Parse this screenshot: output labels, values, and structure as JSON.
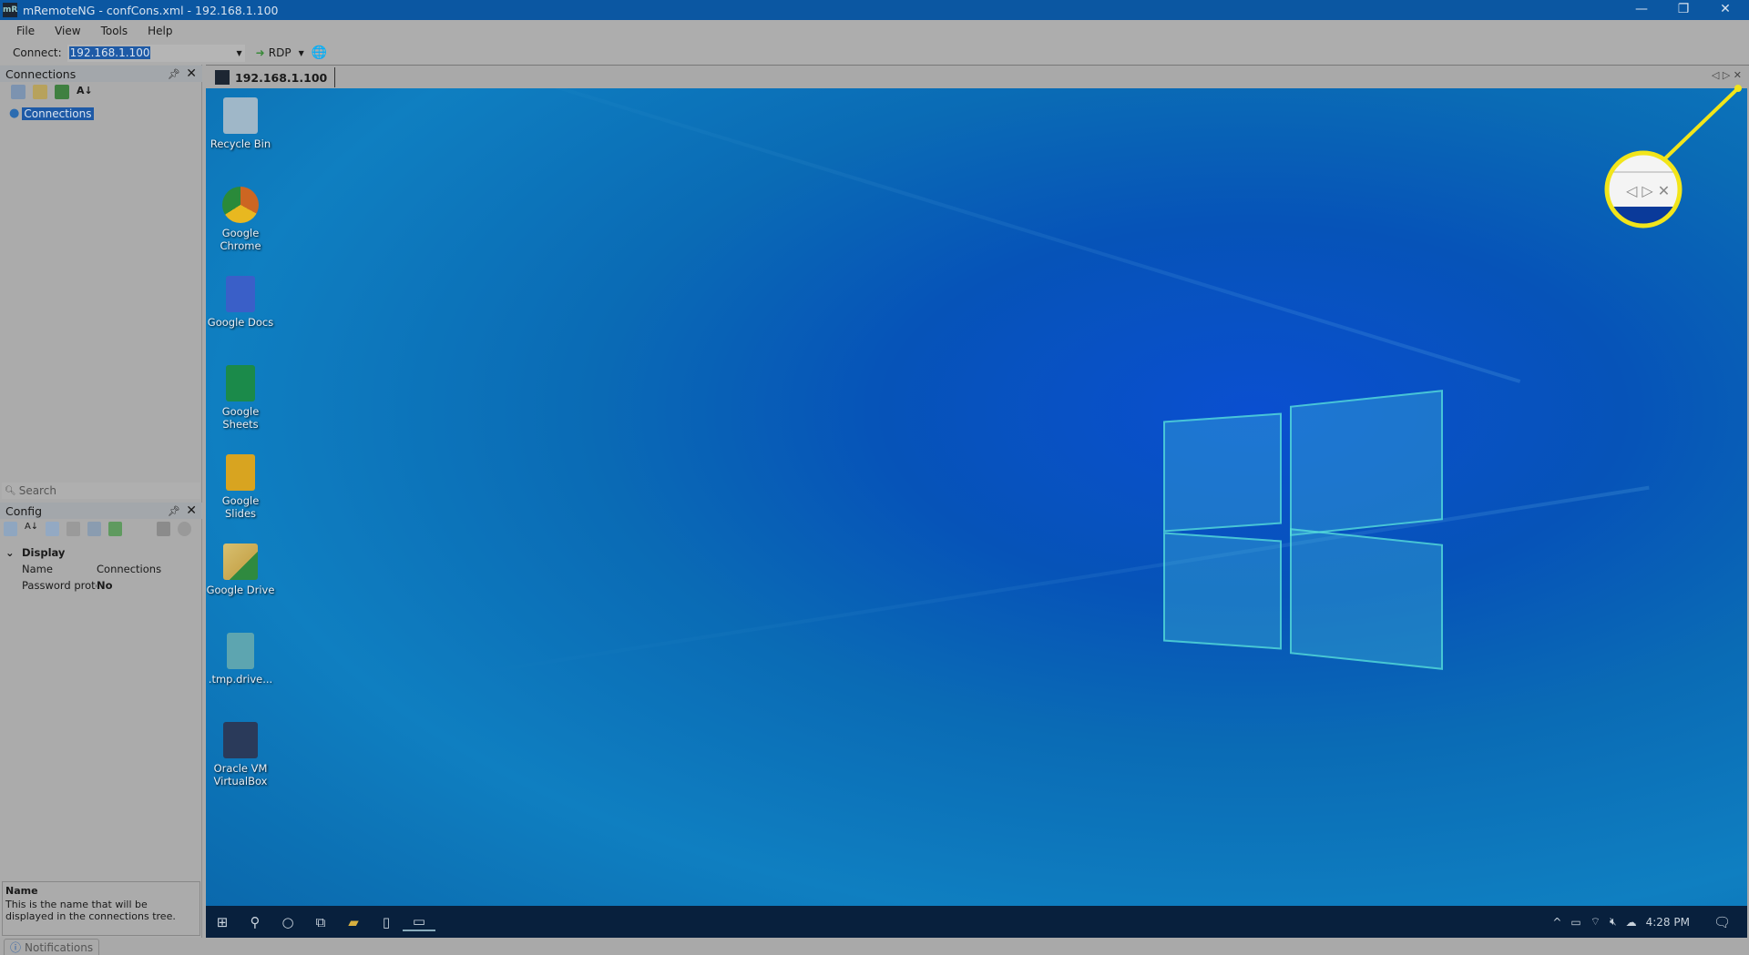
{
  "window": {
    "title": "mRemoteNG - confCons.xml - 192.168.1.100",
    "logo": "mR",
    "minimize": "—",
    "restore": "❐",
    "close": "✕"
  },
  "menu": [
    "File",
    "View",
    "Tools",
    "Help"
  ],
  "toolbar": {
    "connect_label": "Connect:",
    "connect_value": "192.168.1.100",
    "protocol": "RDP"
  },
  "connections_panel": {
    "title": "Connections",
    "tree_root": "Connections",
    "search_placeholder": "Search"
  },
  "config_panel": {
    "title": "Config",
    "category": "Display",
    "rows": [
      {
        "name": "Name",
        "value": "Connections"
      },
      {
        "name": "Password prote",
        "value": "No"
      }
    ],
    "description_title": "Name",
    "description": "This is the name that will be displayed in the connections tree."
  },
  "tab": {
    "label": "192.168.1.100"
  },
  "desktop_icons": [
    "Recycle Bin",
    "Google Chrome",
    "Google Docs",
    "Google Sheets",
    "Google Slides",
    "Google Drive",
    ".tmp.drive...",
    "Oracle VM VirtualBox"
  ],
  "taskbar": {
    "time": "4:28 PM"
  },
  "status": {
    "notifications": "Notifications"
  },
  "colors": {
    "highlight": "#f2e51a",
    "titlebar": "#0b57a2",
    "selection": "#1e5aa6"
  }
}
